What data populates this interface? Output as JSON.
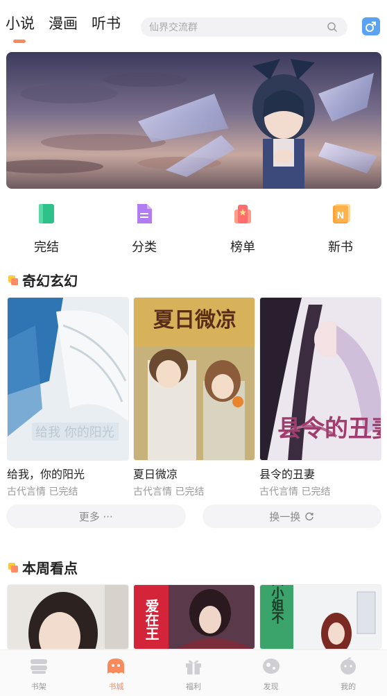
{
  "top_tabs": [
    {
      "label": "小说",
      "active": true
    },
    {
      "label": "漫画",
      "active": false
    },
    {
      "label": "听书",
      "active": false
    }
  ],
  "search": {
    "placeholder": "仙界交流群",
    "icon": "search-icon"
  },
  "gender_toggle": {
    "icon": "male-symbol-icon",
    "symbol": "♂"
  },
  "quick_entries": [
    {
      "label": "完结",
      "icon": "book-icon",
      "color": "#2ec28a"
    },
    {
      "label": "分类",
      "icon": "document-icon",
      "color": "#b17df0"
    },
    {
      "label": "榜单",
      "icon": "ranking-icon",
      "color": "#ff6d6d"
    },
    {
      "label": "新书",
      "icon": "new-book-icon",
      "color": "#ffa23a"
    }
  ],
  "section1": {
    "title": "奇幻玄幻",
    "books": [
      {
        "title": "给我，你的阳光",
        "meta": "古代言情 已完结",
        "cover_text": "给我 你的阳光"
      },
      {
        "title": "夏日微凉",
        "meta": "古代言情 已完结",
        "cover_text": "夏日微凉"
      },
      {
        "title": "县令的丑妻",
        "meta": "古代言情 已完结",
        "cover_text": "县令的丑妻"
      }
    ],
    "more_label": "更多 ···",
    "refresh_label": "换一换"
  },
  "section2": {
    "title": "本周看点",
    "books": [
      {
        "cover_text": ""
      },
      {
        "cover_text": "爱在王"
      },
      {
        "cover_text": "四小姐不"
      }
    ]
  },
  "bottom_nav": [
    {
      "label": "书架",
      "icon": "bookshelf-icon",
      "active": false
    },
    {
      "label": "书城",
      "icon": "bookstore-icon",
      "active": true
    },
    {
      "label": "福利",
      "icon": "gift-icon",
      "active": false
    },
    {
      "label": "发现",
      "icon": "discover-icon",
      "active": false
    },
    {
      "label": "我的",
      "icon": "profile-icon",
      "active": false
    }
  ],
  "colors": {
    "accent": "#f98a5b",
    "muted": "#999999"
  }
}
